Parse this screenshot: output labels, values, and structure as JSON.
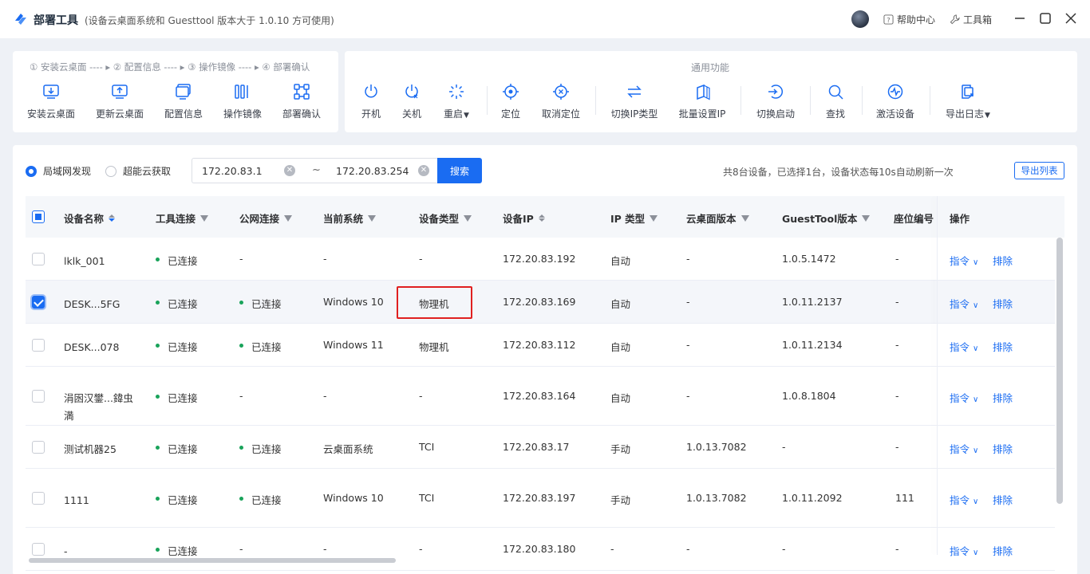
{
  "app": {
    "title": "部署工具",
    "subtitle": "(设备云桌面系统和 Guesttool 版本大于 1.0.10 方可使用)",
    "help": "帮助中心",
    "toolbox": "工具箱"
  },
  "steps_text": "① 安装云桌面 ---- ▸ ② 配置信息 ---- ▸ ③ 操作镜像 ---- ▸ ④ 部署确认",
  "deploy_tools": [
    "安装云桌面",
    "更新云桌面",
    "配置信息",
    "操作镜像",
    "部署确认"
  ],
  "general": {
    "title": "通用功能",
    "tools": [
      "开机",
      "关机",
      "重启",
      "定位",
      "取消定位",
      "切换IP类型",
      "批量设置IP",
      "切换启动",
      "查找",
      "激活设备",
      "导出日志"
    ]
  },
  "filter": {
    "radio1": "局域网发现",
    "radio2": "超能云获取",
    "ip_start": "172.20.83.1",
    "ip_sep": "~",
    "ip_end": "172.20.83.254",
    "search": "搜索",
    "summary": "共8台设备，已选择1台，设备状态每10s自动刷新一次",
    "export": "导出列表"
  },
  "table": {
    "headers": [
      "设备名称",
      "工具连接",
      "公网连接",
      "当前系统",
      "设备类型",
      "设备IP",
      "IP 类型",
      "云桌面版本",
      "GuestTool版本",
      "座位编号",
      "操作"
    ],
    "action_cmd": "指令",
    "action_remove": "排除",
    "rows": [
      {
        "name": "lklk_001",
        "tool": "已连接",
        "net": "-",
        "sys": "-",
        "type": "-",
        "ip": "172.20.83.192",
        "iptype": "自动",
        "cloud": "-",
        "guest": "1.0.5.1472",
        "seat": "-"
      },
      {
        "name": "DESK...5FG",
        "tool": "已连接",
        "net": "已连接",
        "sys": "Windows 10",
        "type": "物理机",
        "ip": "172.20.83.169",
        "iptype": "自动",
        "cloud": "-",
        "guest": "1.0.11.2137",
        "seat": "-"
      },
      {
        "name": "DESK...078",
        "tool": "已连接",
        "net": "已连接",
        "sys": "Windows 11",
        "type": "物理机",
        "ip": "172.20.83.112",
        "iptype": "自动",
        "cloud": "-",
        "guest": "1.0.11.2134",
        "seat": "-"
      },
      {
        "name": "涓囦汉鐢...鍏虫満",
        "tool": "已连接",
        "net": "-",
        "sys": "-",
        "type": "-",
        "ip": "172.20.83.164",
        "iptype": "自动",
        "cloud": "-",
        "guest": "1.0.8.1804",
        "seat": "-"
      },
      {
        "name": "测试机器25",
        "tool": "已连接",
        "net": "已连接",
        "sys": "云桌面系统",
        "type": "TCI",
        "ip": "172.20.83.17",
        "iptype": "手动",
        "cloud": "1.0.13.7082",
        "guest": "-",
        "seat": "-"
      },
      {
        "name": "1111",
        "tool": "已连接",
        "net": "已连接",
        "sys": "Windows 10",
        "type": "TCI",
        "ip": "172.20.83.197",
        "iptype": "手动",
        "cloud": "1.0.13.7082",
        "guest": "1.0.11.2092",
        "seat": "111"
      },
      {
        "name": "-",
        "tool": "已连接",
        "net": "-",
        "sys": "-",
        "type": "-",
        "ip": "172.20.83.180",
        "iptype": "-",
        "cloud": "-",
        "guest": "-",
        "seat": "-"
      }
    ]
  }
}
